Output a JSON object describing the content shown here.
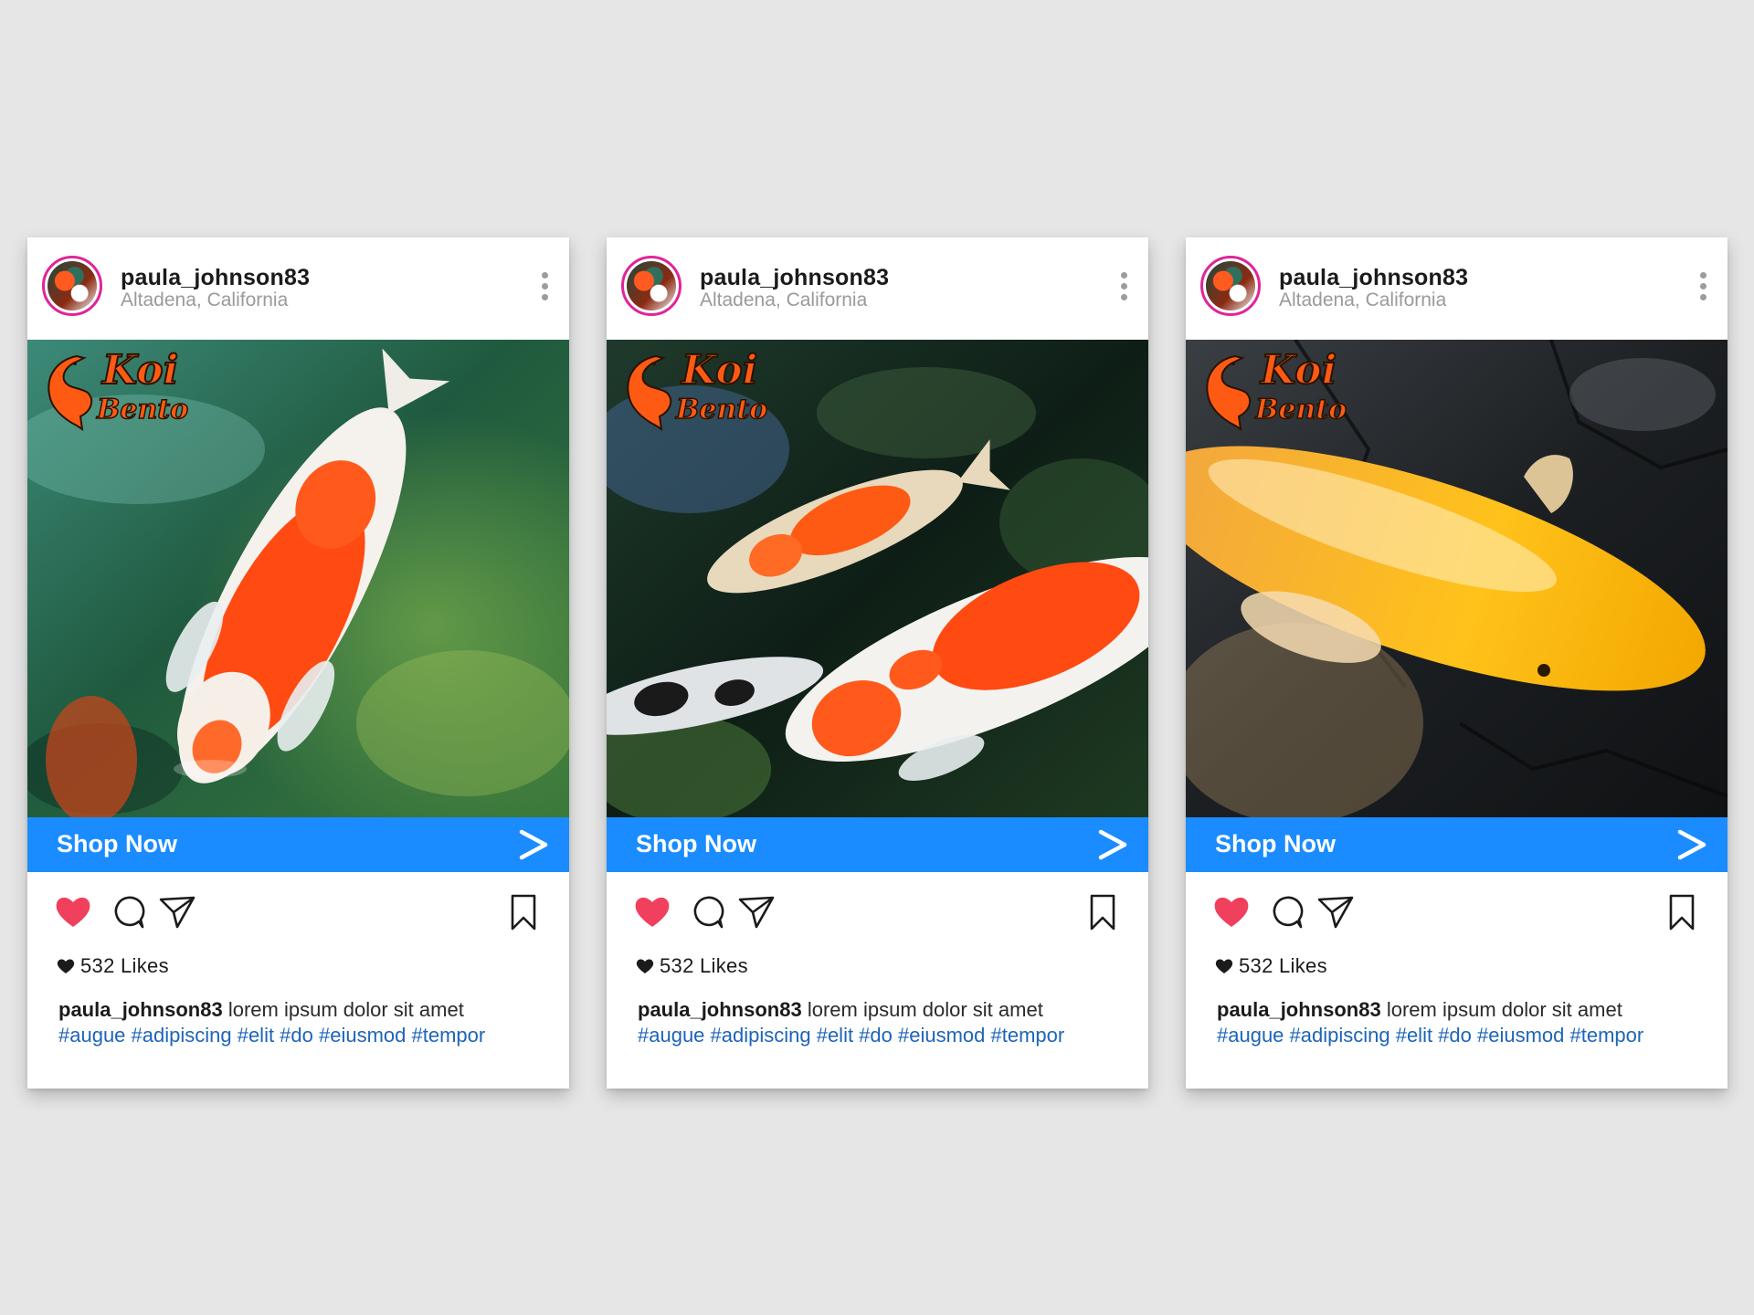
{
  "posts": [
    {
      "username": "paula_johnson83",
      "location": "Altadena, California",
      "brand_line1": "Koi",
      "brand_line2": "Bento",
      "photo_subject": "red-and-white koi swimming over green pond water",
      "cta_label": "Shop Now",
      "cta_arrow": ">",
      "likes": "532 Likes",
      "caption_user": "paula_johnson83",
      "caption_text": " lorem ipsum dolor sit amet",
      "hashtags": "#augue  #adipiscing #elit #do #eiusmod #tempor"
    },
    {
      "username": "paula_johnson83",
      "location": "Altadena, California",
      "brand_line1": "Koi",
      "brand_line2": "Bento",
      "photo_subject": "two orange-and-white koi in dark pond water",
      "cta_label": "Shop Now",
      "cta_arrow": ">",
      "likes": "532 Likes",
      "caption_user": "paula_johnson83",
      "caption_text": " lorem ipsum dolor sit amet",
      "hashtags": "#augue  #adipiscing #elit #do #eiusmod #tempor"
    },
    {
      "username": "paula_johnson83",
      "location": "Altadena, California",
      "brand_line1": "Koi",
      "brand_line2": "Bento",
      "photo_subject": "golden koi over dark stone pond floor",
      "cta_label": "Shop Now",
      "cta_arrow": ">",
      "likes": "532 Likes",
      "caption_user": "paula_johnson83",
      "caption_text": " lorem ipsum dolor sit amet",
      "hashtags": "#augue  #adipiscing #elit #do #eiusmod #tempor"
    }
  ],
  "icons": {
    "more": "more-vertical-icon",
    "like": "heart-icon",
    "comment": "comment-icon",
    "share": "send-icon",
    "save": "bookmark-icon",
    "cta": "arrow-right-icon"
  },
  "colors": {
    "background": "#e6e6e6",
    "cta_bar": "#1a8cff",
    "like_heart": "#f0405e",
    "avatar_ring": "#e0249a",
    "hashtag": "#1d64b8",
    "brand": "#ff5a14"
  }
}
